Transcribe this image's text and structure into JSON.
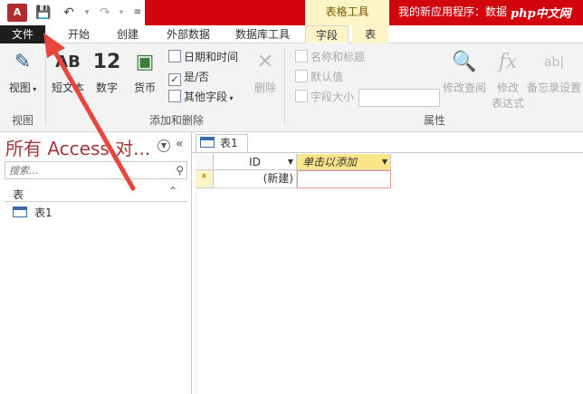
{
  "titlebar": {
    "app_icon": "A",
    "tool_group": "表格工具",
    "app_title": "我的新应用程序：数据",
    "watermark": "php中文网"
  },
  "tabs": {
    "file": "文件",
    "home": "开始",
    "create": "创建",
    "external": "外部数据",
    "dbtools": "数据库工具",
    "fields": "字段",
    "table": "表"
  },
  "ribbon": {
    "view": "视图",
    "view_group": "视图",
    "short_text": "短文本",
    "short_text_icon": "AB",
    "number": "数字",
    "number_icon": "12",
    "currency": "货币",
    "datetime": "日期和时间",
    "yesno": "是/否",
    "more_fields": "其他字段",
    "delete": "删除",
    "add_delete_group": "添加和删除",
    "name_caption": "名称和标题",
    "default_value": "默认值",
    "field_size": "字段大小",
    "modify_lookups": "修改查阅",
    "modify_expr": "修改\n表达式",
    "modify_expr_line1": "修改",
    "modify_expr_line2": "表达式",
    "memo_settings": "备忘录设置",
    "memo_icon": "ab|",
    "fx_icon": "fx",
    "properties_group": "属性"
  },
  "navpane": {
    "title": "所有 Access 对...",
    "search_placeholder": "搜索...",
    "group_header": "表",
    "items": [
      {
        "label": "表1"
      }
    ]
  },
  "document": {
    "tab_label": "表1",
    "columns": [
      {
        "label": "ID"
      },
      {
        "label": "单击以添加"
      }
    ],
    "new_row_marker": "*",
    "new_row_value": "(新建)"
  },
  "colors": {
    "title_red": "#d2040d",
    "access_red": "#a4373a",
    "tool_yellow": "#fdf4c8",
    "arrow": "#e8463c"
  }
}
